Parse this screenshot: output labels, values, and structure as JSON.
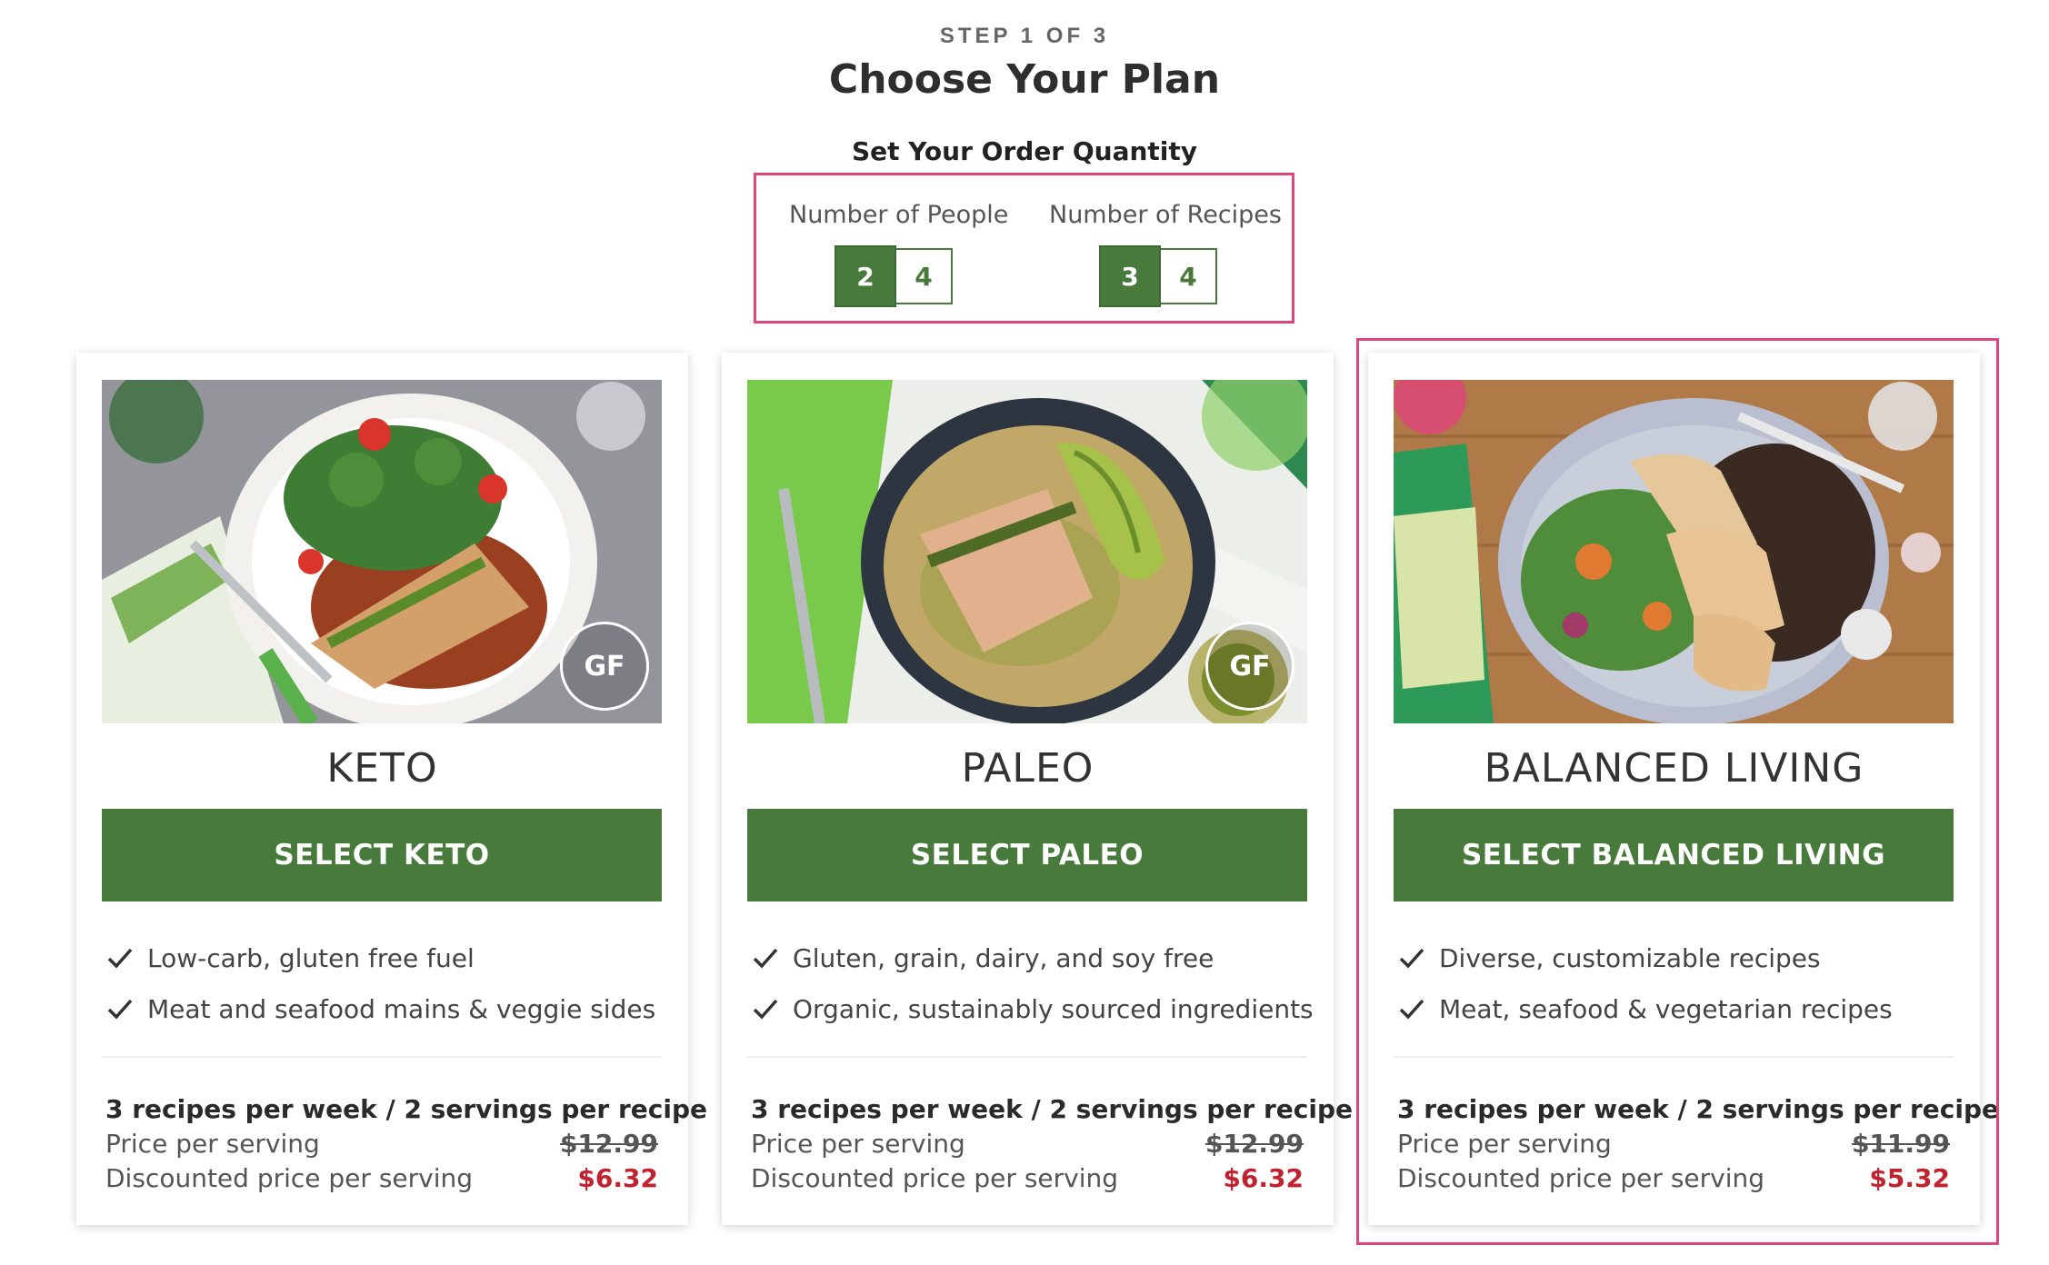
{
  "header": {
    "step": "STEP 1 OF 3",
    "title": "Choose Your Plan",
    "quantity_heading": "Set Your Order Quantity"
  },
  "quantity": {
    "people": {
      "label": "Number of People",
      "options": [
        "2",
        "4"
      ],
      "selected": "2"
    },
    "recipes": {
      "label": "Number of Recipes",
      "options": [
        "3",
        "4"
      ],
      "selected": "3"
    }
  },
  "plans": [
    {
      "name": "KETO",
      "button": "SELECT KETO",
      "features": [
        "Low-carb, gluten free fuel",
        "Meat and seafood mains & veggie sides"
      ],
      "summary": "3 recipes per week / 2 servings per recipe",
      "price_label": "Price per serving",
      "price": "$12.99",
      "discount_label": "Discounted price per serving",
      "discount_price": "$6.32",
      "badge": "GF"
    },
    {
      "name": "PALEO",
      "button": "SELECT PALEO",
      "features": [
        "Gluten, grain, dairy, and soy free",
        "Organic, sustainably sourced ingredients"
      ],
      "summary": "3 recipes per week / 2 servings per recipe",
      "price_label": "Price per serving",
      "price": "$12.99",
      "discount_label": "Discounted price per serving",
      "discount_price": "$6.32",
      "badge": "GF"
    },
    {
      "name": "BALANCED LIVING",
      "button": "SELECT BALANCED LIVING",
      "features": [
        "Diverse, customizable recipes",
        "Meat, seafood & vegetarian recipes"
      ],
      "summary": "3 recipes per week / 2 servings per recipe",
      "price_label": "Price per serving",
      "price": "$11.99",
      "discount_label": "Discounted price per serving",
      "discount_price": "$5.32"
    }
  ],
  "colors": {
    "brand_green": "#487a3b",
    "discount_red": "#c0232f",
    "highlight_pink": "#e0457b"
  }
}
